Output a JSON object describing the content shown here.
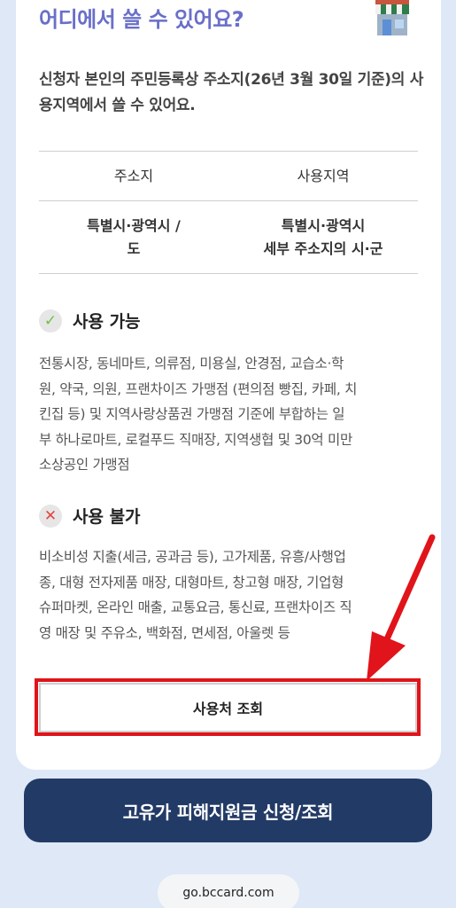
{
  "section": {
    "title": "어디에서 쓸 수 있어요?",
    "description": "신청자 본인의 주민등록상 주소지(26년 3월 30일 기준)의 사용지역에서 쓸 수 있어요."
  },
  "table": {
    "headers": [
      "주소지",
      "사용지역"
    ],
    "row": {
      "address": [
        "특별시·광역시 /",
        "도"
      ],
      "area": [
        "특별시·광역시",
        "세부 주소지의 시·군"
      ]
    }
  },
  "available": {
    "title": "사용 가능",
    "lines": [
      "전통시장, 동네마트, 의류점, 미용실, 안경점, 교습소·학",
      "원, 약국, 의원, 프랜차이즈 가맹점 (편의점 빵집, 카페, 치",
      "킨집 등) 및 지역사랑상품권 가맹점 기준에 부합하는 일",
      "부 하나로마트, 로컬푸드 직매장, 지역생협 및 30억 미만",
      "소상공인 가맹점"
    ]
  },
  "unavailable": {
    "title": "사용 불가",
    "lines": [
      "비소비성 지출(세금, 공과금 등), 고가제품, 유흥/사행업",
      "종, 대형 전자제품 매장, 대형마트, 창고형 매장, 기업형",
      "슈퍼마켓, 온라인 매출, 교통요금, 통신료, 프랜차이즈 직",
      "영 매장 및 주유소, 백화점, 면세점, 아울렛 등"
    ]
  },
  "buttons": {
    "lookup": "사용처 조회",
    "apply": "고유가 피해지원금 신청/조회"
  },
  "browser": {
    "url": "go.bccard.com"
  },
  "colors": {
    "title": "#6a6fc9",
    "primary_button": "#223a66",
    "highlight": "#e0141a",
    "background": "#dfe8f7"
  },
  "icons": {
    "store": "store-icon",
    "available": "check-icon",
    "unavailable": "x-icon"
  }
}
